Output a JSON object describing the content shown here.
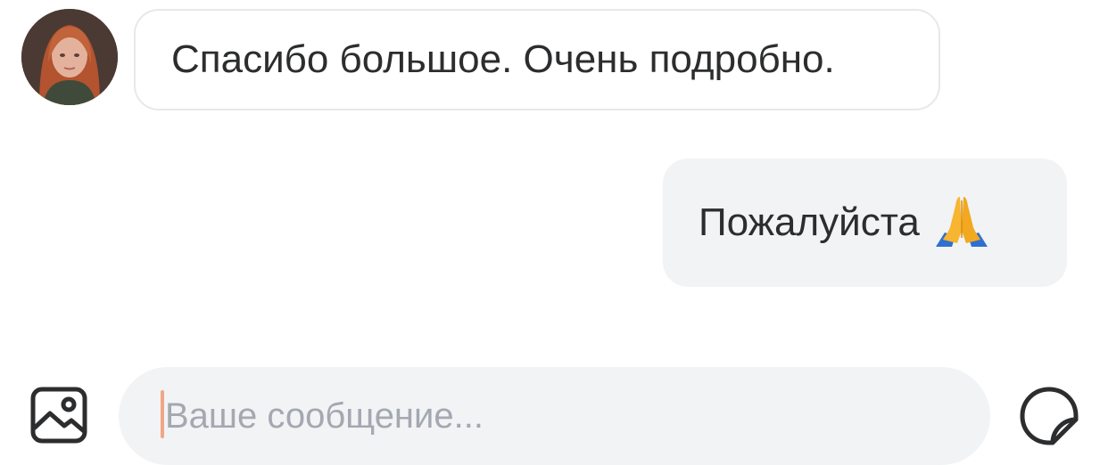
{
  "messages": [
    {
      "direction": "incoming",
      "text": "Спасибо большое. Очень подробно."
    },
    {
      "direction": "outgoing",
      "text": "Пожалуйста",
      "emoji": "folded-hands"
    }
  ],
  "composer": {
    "placeholder": "Ваше сообщение...",
    "value": ""
  },
  "icons": {
    "attach": "image-icon",
    "sticker": "sticker-icon"
  },
  "colors": {
    "outgoing_bubble": "#f2f3f5",
    "incoming_border": "#e7e8ea",
    "text": "#2c2d2e",
    "placeholder": "#a3a8b1",
    "caret": "#f0a687"
  }
}
